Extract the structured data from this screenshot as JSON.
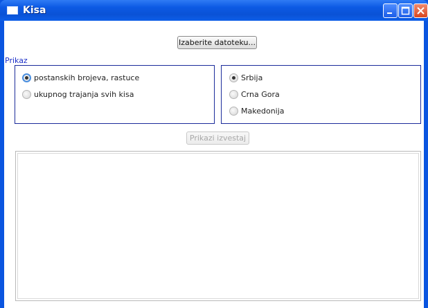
{
  "window": {
    "title": "Kisa"
  },
  "toolbar": {
    "choose_file_label": "Izaberite datoteku..."
  },
  "display": {
    "section_label": "Prikaz",
    "sort_options": [
      {
        "label": "postanskih brojeva, rastuce",
        "selected": true
      },
      {
        "label": "ukupnog trajanja svih kisa",
        "selected": false
      }
    ],
    "country_options": [
      {
        "label": "Srbija",
        "selected": true
      },
      {
        "label": "Crna Gora",
        "selected": false
      },
      {
        "label": "Makedonija",
        "selected": false
      }
    ]
  },
  "actions": {
    "show_report_label": "Prikazi izvestaj",
    "show_report_enabled": false
  },
  "output": {
    "text": ""
  },
  "colors": {
    "title_bar": "#0a52d6",
    "group_border": "#1a2a9a",
    "section_label": "#1c2fc8"
  }
}
